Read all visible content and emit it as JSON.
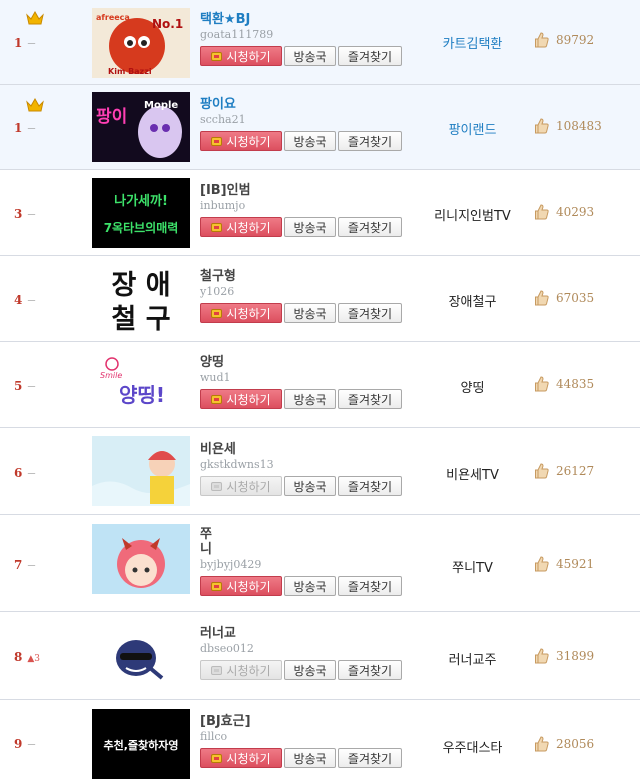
{
  "labels": {
    "watch": "시청하기",
    "station": "방송국",
    "favorite": "즐겨찾기"
  },
  "rows": [
    {
      "rank": "1",
      "change": "ㅡ",
      "crown": true,
      "name": "택환★BJ",
      "id": "goata111789",
      "channel": "카트김택환",
      "score": "89792",
      "live": true,
      "thumb_text": "No.1",
      "thumb_sub": "Kim Bazzi",
      "thumb_top": "afreeca"
    },
    {
      "rank": "1",
      "change": "ㅡ",
      "crown": true,
      "name": "팡이요",
      "id": "sccha21",
      "channel": "팡이랜드",
      "score": "108483",
      "live": true,
      "thumb_text": "팡이",
      "thumb_sub": "Mople"
    },
    {
      "rank": "3",
      "change": "ㅡ",
      "crown": false,
      "name": "[IB]인범",
      "id": "inbumjo",
      "channel": "리니지인범TV",
      "score": "40293",
      "live": true,
      "thumb_text": "나가세까!",
      "thumb_sub": "7옥타브의매력"
    },
    {
      "rank": "4",
      "change": "ㅡ",
      "crown": false,
      "name": "철구형",
      "id": "y1026",
      "channel": "장애철구",
      "score": "67035",
      "live": true,
      "thumb_text": "장 애",
      "thumb_sub": "철 구"
    },
    {
      "rank": "5",
      "change": "ㅡ",
      "crown": false,
      "name": "양띵",
      "id": "wud1",
      "channel": "양띵",
      "score": "44835",
      "live": true,
      "thumb_text": "양띵!",
      "thumb_sub": "Smile"
    },
    {
      "rank": "6",
      "change": "ㅡ",
      "crown": false,
      "name": "비욘세",
      "id": "gkstkdwns13",
      "channel": "비욘세TV",
      "score": "26127",
      "live": false
    },
    {
      "rank": "7",
      "change": "ㅡ",
      "crown": false,
      "name": "쭈\n니",
      "id": "byjbyj0429",
      "channel": "쭈니TV",
      "score": "45921",
      "live": true
    },
    {
      "rank": "8",
      "change": "▲3",
      "crown": false,
      "name": "러너교",
      "id": "dbseo012",
      "channel": "러너교주",
      "score": "31899",
      "live": false
    },
    {
      "rank": "9",
      "change": "ㅡ",
      "crown": false,
      "name": "[BJ효근]",
      "id": "fillco",
      "channel": "우주대스타",
      "score": "28056",
      "live": true,
      "thumb_text": "추천,즐찾하자영"
    }
  ]
}
